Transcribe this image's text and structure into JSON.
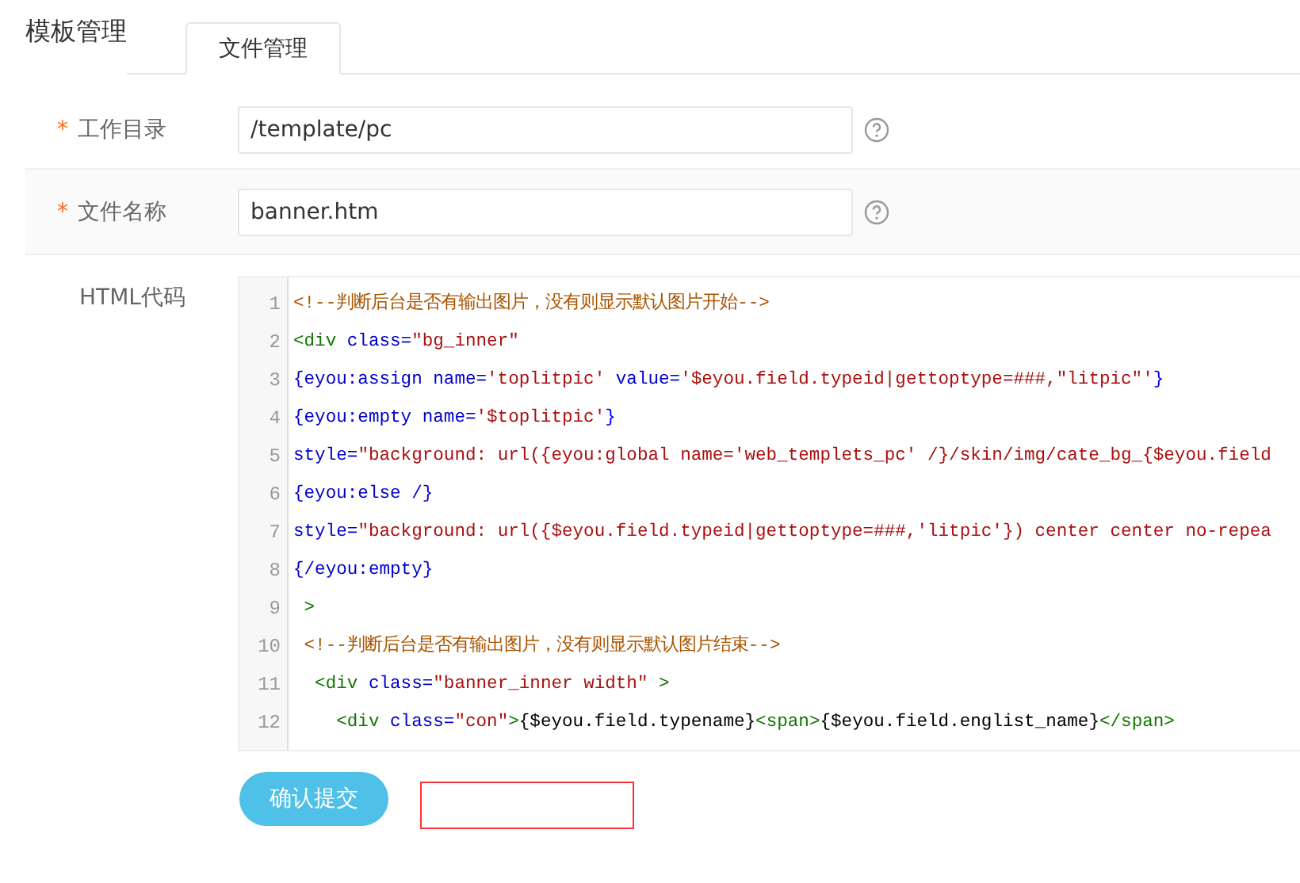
{
  "tabs": [
    {
      "label": "模板管理",
      "selected": false
    },
    {
      "label": "文件管理",
      "selected": true
    }
  ],
  "fields": [
    {
      "label": "工作目录",
      "required_mark": "*",
      "value": "/template/pc"
    },
    {
      "label": "文件名称",
      "required_mark": "*",
      "value": "banner.htm"
    }
  ],
  "code_editor": {
    "label": "HTML代码",
    "lines": [
      {
        "number": "1",
        "tokens": [
          {
            "kind": "comment",
            "text": "<!--判断后台是否有输出图片，没有则显示默认图片开始-->"
          }
        ]
      },
      {
        "number": "2",
        "tokens": [
          {
            "kind": "tag",
            "text": "<div"
          },
          {
            "kind": "attr",
            "text": " class="
          },
          {
            "kind": "value",
            "text": "\"bg_inner\""
          }
        ]
      },
      {
        "number": "3",
        "tokens": [
          {
            "kind": "attr",
            "text": "{eyou:assign name="
          },
          {
            "kind": "value",
            "text": "'toplitpic'"
          },
          {
            "kind": "attr",
            "text": " value="
          },
          {
            "kind": "value",
            "text": "'$eyou.field.typeid|gettoptype=###,\"litpic\"'"
          },
          {
            "kind": "brace",
            "text": "}"
          }
        ]
      },
      {
        "number": "4",
        "tokens": [
          {
            "kind": "attr",
            "text": "{eyou:empty name="
          },
          {
            "kind": "value",
            "text": "'$toplitpic'"
          },
          {
            "kind": "brace",
            "text": "}"
          }
        ]
      },
      {
        "number": "5",
        "tokens": [
          {
            "kind": "attr",
            "text": "style="
          },
          {
            "kind": "value",
            "text": "\"background: url({eyou:global name='web_templets_pc' /}/skin/img/cate_bg_{$eyou.field"
          }
        ]
      },
      {
        "number": "6",
        "tokens": [
          {
            "kind": "attr",
            "text": "{eyou:else /}"
          }
        ]
      },
      {
        "number": "7",
        "tokens": [
          {
            "kind": "attr",
            "text": "style="
          },
          {
            "kind": "value",
            "text": "\"background: url({$eyou.field.typeid|gettoptype=###,'litpic'}) center center no-repea"
          }
        ]
      },
      {
        "number": "8",
        "tokens": [
          {
            "kind": "attr",
            "text": "{/eyou:empty}"
          }
        ]
      },
      {
        "number": "9",
        "tokens": [
          {
            "kind": "tag",
            "text": " >"
          }
        ]
      },
      {
        "number": "10",
        "tokens": [
          {
            "kind": "comment",
            "text": " <!--判断后台是否有输出图片，没有则显示默认图片结束-->"
          }
        ]
      },
      {
        "number": "11",
        "tokens": [
          {
            "kind": "tag",
            "text": "  <div"
          },
          {
            "kind": "attr",
            "text": " class="
          },
          {
            "kind": "value",
            "text": "\"banner_inner width\""
          },
          {
            "kind": "tag",
            "text": " >"
          }
        ]
      },
      {
        "number": "12",
        "tokens": [
          {
            "kind": "tag",
            "text": "    <div"
          },
          {
            "kind": "attr",
            "text": " class="
          },
          {
            "kind": "value",
            "text": "\"con\""
          },
          {
            "kind": "tag",
            "text": ">"
          },
          {
            "kind": "plain",
            "text": "{$eyou.field.typename}"
          },
          {
            "kind": "tag",
            "text": "<span>"
          },
          {
            "kind": "plain",
            "text": "{$eyou.field.englist_name}"
          },
          {
            "kind": "tag",
            "text": "</span>"
          }
        ]
      }
    ]
  },
  "submit_button": "确认提交"
}
